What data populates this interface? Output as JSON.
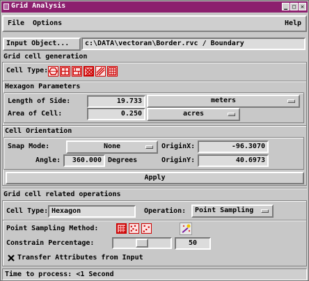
{
  "window": {
    "title": "Grid Analysis"
  },
  "menu": {
    "file": "File",
    "options": "Options",
    "help": "Help"
  },
  "input": {
    "button_label": "Input Object...",
    "path": "c:\\DATA\\vectoran\\Border.rvc / Boundary"
  },
  "generation": {
    "section_title": "Grid cell generation",
    "cell_type_label": "Cell Type:",
    "cell_types": [
      "hexagon",
      "square-grid",
      "rectangle-grid",
      "diamond",
      "diagonal-lines",
      "dense-grid"
    ],
    "selected_cell_type_index": 3,
    "hex_params_title": "Hexagon Parameters",
    "length_label": "Length of Side:",
    "length_value": "19.733",
    "length_unit": "meters",
    "area_label": "Area of Cell:",
    "area_value": "0.250",
    "area_unit": "acres",
    "orientation_title": "Cell Orientation",
    "snap_label": "Snap Mode:",
    "snap_value": "None",
    "originx_label": "OriginX:",
    "originx_value": "-96.3070",
    "angle_label": "Angle:",
    "angle_value": "360.000",
    "angle_unit": "Degrees",
    "originy_label": "OriginY:",
    "originy_value": "40.6973",
    "apply_label": "Apply"
  },
  "operations": {
    "section_title": "Grid cell related operations",
    "cell_type_label": "Cell Type:",
    "cell_type_value": "Hexagon",
    "operation_label": "Operation:",
    "operation_value": "Point Sampling",
    "sampling_label": "Point Sampling Method:",
    "sampling_methods": [
      "regular-points",
      "random-points",
      "scattered-points"
    ],
    "selected_sampling_index": 0,
    "constrain_label": "Constrain Percentage:",
    "constrain_value": "50",
    "constrain_fraction": 0.5,
    "transfer_label": "Transfer Attributes from Input",
    "transfer_checked": true
  },
  "status": {
    "text": "Time to process: <1 Second"
  },
  "colors": {
    "title_bar": "#8c1f6e",
    "icon_red": "#cc0000",
    "icon_bg": "#fde2e2"
  }
}
